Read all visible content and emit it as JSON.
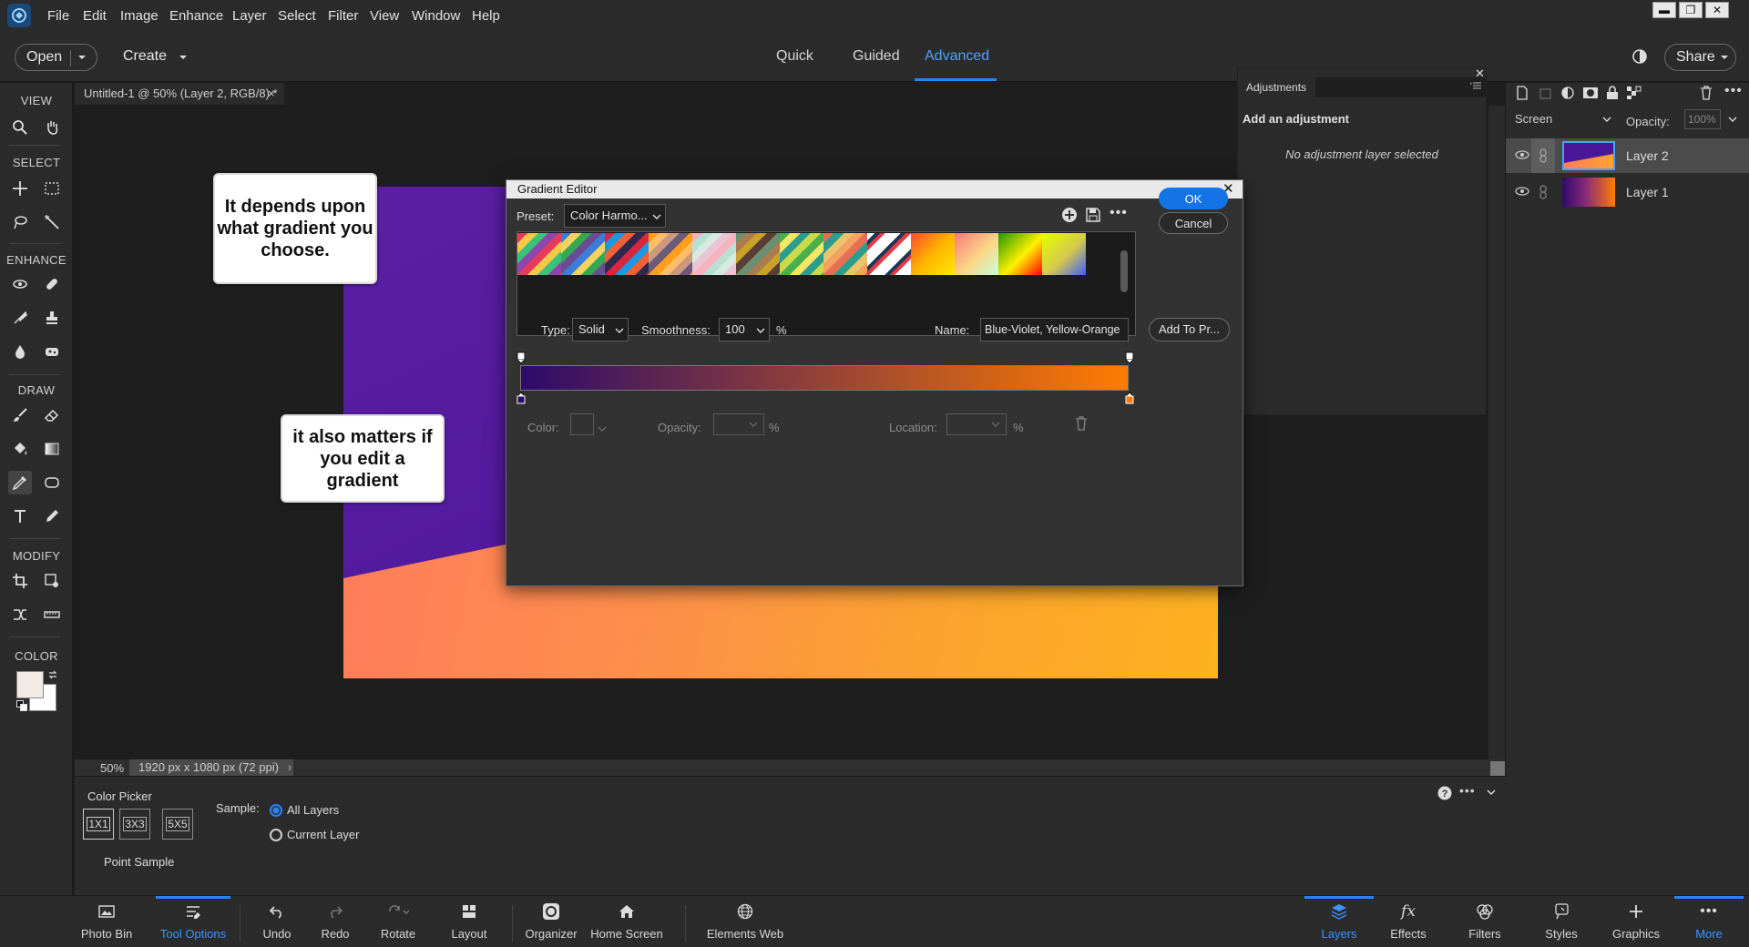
{
  "menu": [
    "File",
    "Edit",
    "Image",
    "Enhance",
    "Layer",
    "Select",
    "Filter",
    "View",
    "Window",
    "Help"
  ],
  "window_controls": {
    "minimize": "▬",
    "restore": "❐",
    "close": "✕"
  },
  "topbar": {
    "open_label": "Open",
    "create_label": "Create",
    "modes": [
      "Quick",
      "Guided",
      "Advanced"
    ],
    "share_label": "Share"
  },
  "toolbox": {
    "sections": [
      "VIEW",
      "SELECT",
      "ENHANCE",
      "DRAW",
      "MODIFY",
      "COLOR"
    ]
  },
  "document": {
    "tab_title": "Untitled-1 @ 50% (Layer 2, RGB/8) *",
    "tab_close": "×"
  },
  "status": {
    "zoom": "50%",
    "doc_size": "1920 px x 1080 px (72 ppi)"
  },
  "callouts": [
    "It depends upon what gradient you choose.",
    "it also matters if you edit a gradient"
  ],
  "adjustments": {
    "tab": "Adjustments",
    "heading": "Add an adjustment",
    "empty": "No adjustment layer selected"
  },
  "layers": {
    "blend_mode": "Screen",
    "opacity_label": "Opacity:",
    "opacity_value": "100%",
    "items": [
      {
        "name": "Layer 2"
      },
      {
        "name": "Layer 1"
      }
    ]
  },
  "gradient_editor": {
    "title": "Gradient Editor",
    "preset_label": "Preset:",
    "preset_value": "Color Harmo...",
    "ok": "OK",
    "cancel": "Cancel",
    "type_label": "Type:",
    "type_value": "Solid",
    "smoothness_label": "Smoothness:",
    "smoothness_value": "100",
    "percent": "%",
    "name_label": "Name:",
    "name_value": "Blue-Violet, Yellow-Orange",
    "add_button": "Add To Pr...",
    "color_label": "Color:",
    "opacity_label": "Opacity:",
    "location_label": "Location:",
    "gradient_colors": {
      "start": "#2d0b6b",
      "end": "#ff7c00"
    }
  },
  "tool_options": {
    "tool_name": "Color Picker",
    "sizes": [
      "1X1",
      "3X3",
      "5X5"
    ],
    "sample_label": "Sample:",
    "sample_options": [
      "All Layers",
      "Current Layer"
    ],
    "sample_selected": "All Layers",
    "point_sample": "Point Sample"
  },
  "bottombar": {
    "left": [
      "Photo Bin",
      "Tool Options",
      "Undo",
      "Redo",
      "Rotate",
      "Layout",
      "Organizer",
      "Home Screen",
      "Elements Web"
    ],
    "right": [
      "Layers",
      "Effects",
      "Filters",
      "Styles",
      "Graphics",
      "More"
    ],
    "active": [
      "Tool Options",
      "Layers",
      "More"
    ]
  },
  "colors": {
    "accent": "#2a84ff",
    "panel": "#2b2b2b",
    "canvas_bg": "#1e1e1e"
  }
}
